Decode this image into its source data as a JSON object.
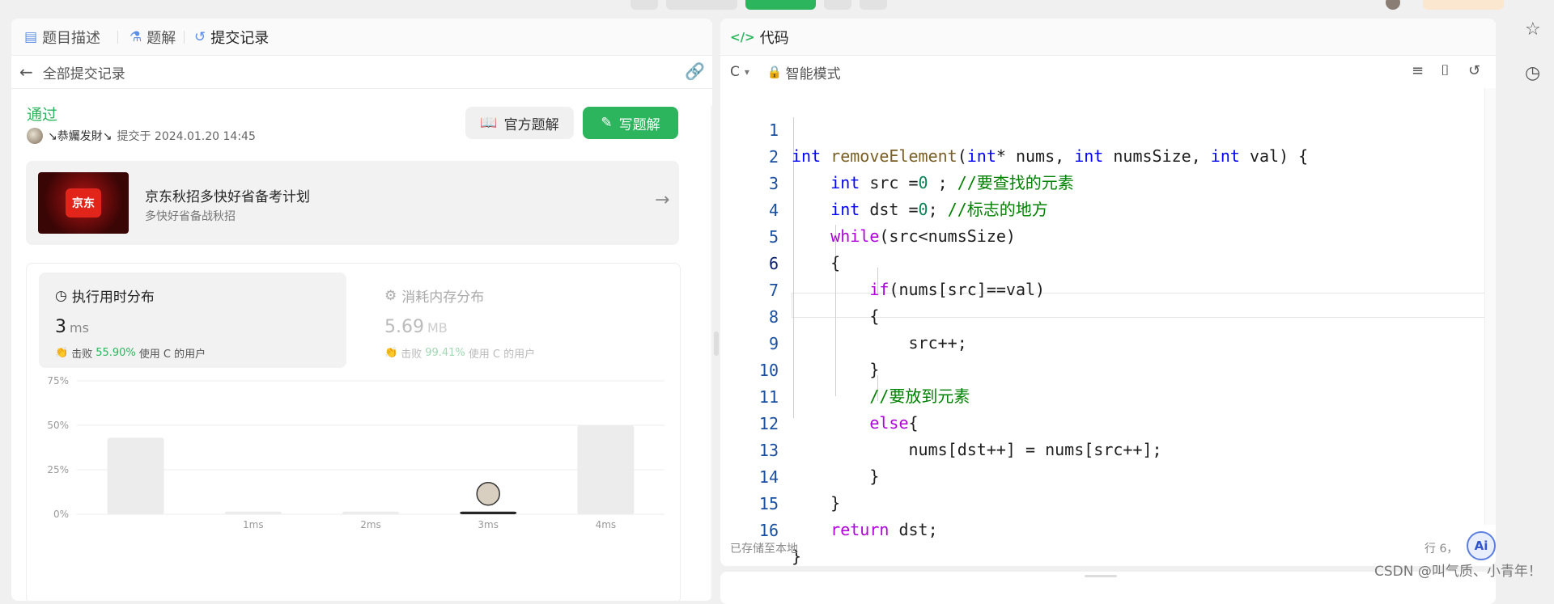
{
  "left_panel": {
    "tabs": [
      {
        "label": "题目描述",
        "icon": "document-icon"
      },
      {
        "label": "题解",
        "icon": "flask-icon"
      },
      {
        "label": "提交记录",
        "icon": "history-icon"
      }
    ],
    "breadcrumb": "全部提交记录",
    "submission": {
      "status": "通过",
      "user": "↘恭孎发財↘",
      "submitted_at": "提交于 2024.01.20 14:45"
    },
    "buttons": {
      "official": "官方题解",
      "write": "写题解"
    },
    "ad": {
      "logo_text": "京东",
      "title": "京东秋招多快好省备考计划",
      "subtitle": "多快好省备战秋招"
    },
    "runtime_card": {
      "title": "执行用时分布",
      "value": "3",
      "unit": "ms",
      "beat_label": "击败",
      "beat_pct": "55.90%",
      "beat_suffix": "使用 C 的用户"
    },
    "memory_card": {
      "title": "消耗内存分布",
      "value": "5.69",
      "unit": "MB",
      "beat_label": "击败",
      "beat_pct": "99.41%",
      "beat_suffix": "使用 C 的用户"
    }
  },
  "chart_data": {
    "type": "bar",
    "categories": [
      "",
      "1ms",
      "2ms",
      "3ms",
      "4ms"
    ],
    "values": [
      43,
      1.5,
      1.5,
      1.5,
      50
    ],
    "highlight_index": 3,
    "y_ticks": [
      "75%",
      "50%",
      "25%",
      "0%"
    ],
    "ylim": [
      0,
      75
    ],
    "grid": true,
    "colors": {
      "bar": "#ececec",
      "highlight": "#262626"
    }
  },
  "right_panel": {
    "title": "代码",
    "language": "C",
    "mode": "智能模式",
    "footer_left": "已存储至本地",
    "footer_right": "行 6，",
    "code_lines": [
      {
        "n": "1"
      },
      {
        "n": "2"
      },
      {
        "n": "3"
      },
      {
        "n": "4"
      },
      {
        "n": "5"
      },
      {
        "n": "6"
      },
      {
        "n": "7"
      },
      {
        "n": "8"
      },
      {
        "n": "9"
      },
      {
        "n": "10"
      },
      {
        "n": "11"
      },
      {
        "n": "12"
      },
      {
        "n": "13"
      },
      {
        "n": "14"
      },
      {
        "n": "15"
      },
      {
        "n": "16"
      }
    ],
    "code": {
      "l1_kw": "int",
      "l1_fn": "removeElement",
      "l1_a": "(",
      "l1_k2": "int",
      "l1_b": "* nums, ",
      "l1_k3": "int",
      "l1_c": " numsSize, ",
      "l1_k4": "int",
      "l1_d": " val) {",
      "l2_kw": "int",
      "l2_a": " src =",
      "l2_num": "0",
      "l2_b": " ; ",
      "l2_cm": "//要查找的元素",
      "l3_kw": "int",
      "l3_a": " dst =",
      "l3_num": "0",
      "l3_b": "; ",
      "l3_cm": "//标志的地方",
      "l4_kw": "while",
      "l4_a": "(src<numsSize)",
      "l5": "{",
      "l6_kw": "if",
      "l6_a": "(nums[src]==val)",
      "l7": "{",
      "l8": "src++;",
      "l9": "}",
      "l10_cm": "//要放到元素",
      "l11_kw": "else",
      "l11_a": "{",
      "l12": "nums[dst++] = nums[src++];",
      "l13": "}",
      "l14": "}",
      "l15_kw": "return",
      "l15_a": " dst;",
      "l16": "}"
    }
  },
  "watermark": "CSDN @叫气质、小青年！",
  "ai_badge": "Ai"
}
